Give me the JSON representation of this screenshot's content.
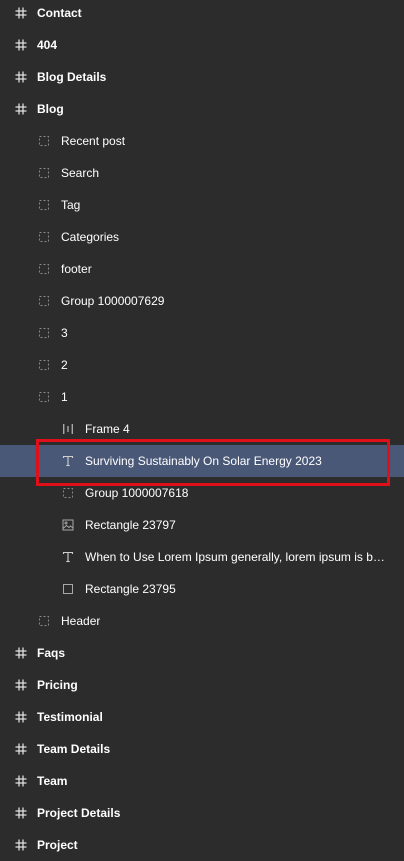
{
  "layers": [
    {
      "label": "Contact",
      "icon": "hash-frame-icon",
      "level": 0
    },
    {
      "label": "404",
      "icon": "hash-frame-icon",
      "level": 0
    },
    {
      "label": "Blog Details",
      "icon": "hash-frame-icon",
      "level": 0
    },
    {
      "label": "Blog",
      "icon": "hash-frame-icon",
      "level": 0
    },
    {
      "label": "Recent post",
      "icon": "dashed-group-icon",
      "level": 1
    },
    {
      "label": "Search",
      "icon": "dashed-group-icon",
      "level": 1
    },
    {
      "label": "Tag",
      "icon": "dashed-group-icon",
      "level": 1
    },
    {
      "label": "Categories",
      "icon": "dashed-group-icon",
      "level": 1
    },
    {
      "label": "footer",
      "icon": "dashed-group-icon",
      "level": 1
    },
    {
      "label": "Group 1000007629",
      "icon": "dashed-group-icon",
      "level": 1
    },
    {
      "label": "3",
      "icon": "dashed-group-icon",
      "level": 1
    },
    {
      "label": "2",
      "icon": "dashed-group-icon",
      "level": 1
    },
    {
      "label": "1",
      "icon": "dashed-group-icon",
      "level": 1
    },
    {
      "label": "Frame 4",
      "icon": "auto-layout-icon",
      "level": 2
    },
    {
      "label": "Surviving Sustainably On Solar Energy 2023",
      "icon": "text-icon",
      "level": 2,
      "selected": true
    },
    {
      "label": "Group 1000007618",
      "icon": "dashed-group-icon",
      "level": 2
    },
    {
      "label": "Rectangle 23797",
      "icon": "image-icon",
      "level": 2
    },
    {
      "label": "When to Use Lorem Ipsum generally, lorem ipsum is best suited",
      "icon": "text-icon",
      "level": 2
    },
    {
      "label": "Rectangle 23795",
      "icon": "rectangle-icon",
      "level": 2
    },
    {
      "label": "Header",
      "icon": "dashed-group-icon",
      "level": 1
    },
    {
      "label": "Faqs",
      "icon": "hash-frame-icon",
      "level": 0
    },
    {
      "label": "Pricing",
      "icon": "hash-frame-icon",
      "level": 0
    },
    {
      "label": "Testimonial",
      "icon": "hash-frame-icon",
      "level": 0
    },
    {
      "label": "Team Details",
      "icon": "hash-frame-icon",
      "level": 0
    },
    {
      "label": "Team",
      "icon": "hash-frame-icon",
      "level": 0
    },
    {
      "label": "Project Details",
      "icon": "hash-frame-icon",
      "level": 0
    },
    {
      "label": "Project",
      "icon": "hash-frame-icon",
      "level": 0
    }
  ],
  "colors": {
    "background": "#2c2c2c",
    "selected_row": "#4a5878",
    "annotation": "#e0101a"
  }
}
